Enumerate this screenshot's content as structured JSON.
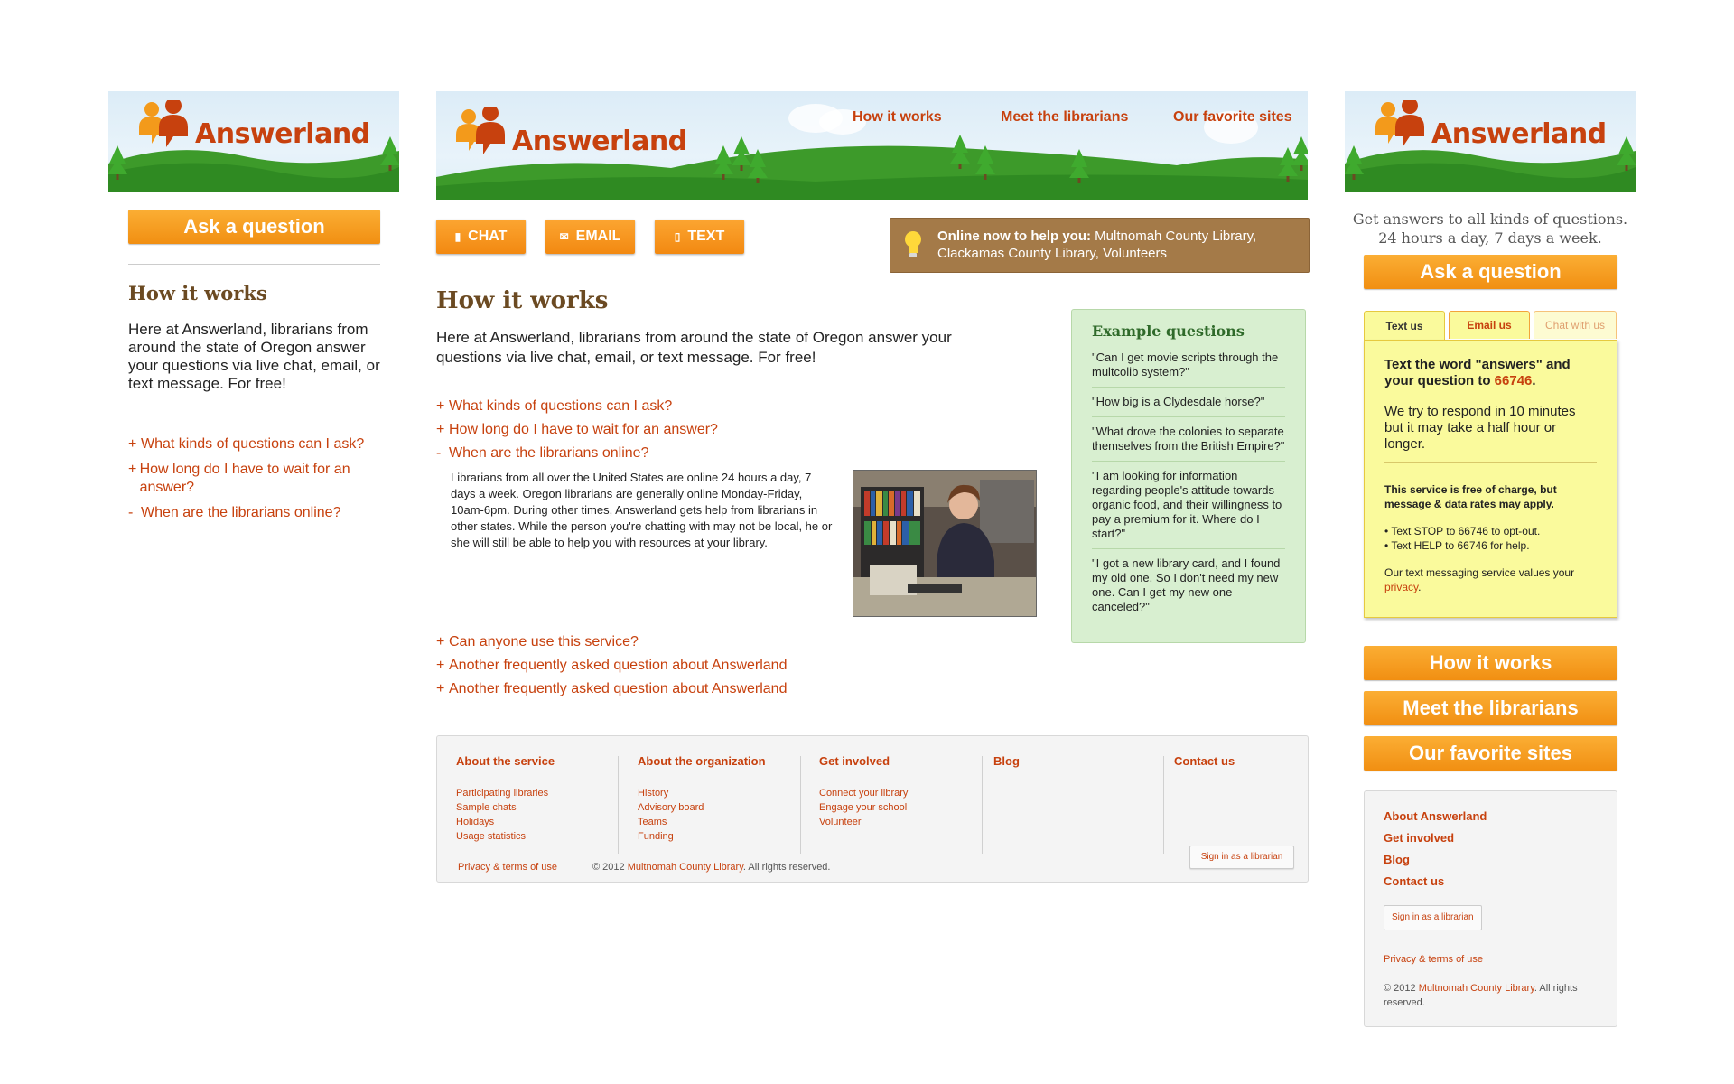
{
  "brand": {
    "name": "Answerland"
  },
  "nav": [
    "How it works",
    "Meet the librarians",
    "Our favorite sites"
  ],
  "left": {
    "ask_button": "Ask a question",
    "heading": "How it works",
    "intro": "Here at Answerland, librarians from around the state of Oregon answer your questions via live chat, email, or text message. For free!",
    "faqs": [
      {
        "sign": "+",
        "text": "What kinds of questions can I ask?"
      },
      {
        "sign": "+",
        "text": "How long do I have to wait for an answer?"
      },
      {
        "sign": "-",
        "text": "When are the librarians online?"
      }
    ]
  },
  "center": {
    "contact_buttons": [
      {
        "label": "CHAT",
        "icon": "chat-bubble-icon"
      },
      {
        "label": "EMAIL",
        "icon": "envelope-icon"
      },
      {
        "label": "TEXT",
        "icon": "phone-icon"
      }
    ],
    "online": {
      "label": "Online now to help you:",
      "value": "Multnomah County Library, Clackamas County Library, Volunteers"
    },
    "heading": "How it works",
    "intro": "Here at Answerland, librarians from around the state of Oregon answer your questions via live chat, email, or text message. For free!",
    "faqs_top": [
      {
        "sign": "+",
        "text": "What kinds of questions can I ask?"
      },
      {
        "sign": "+",
        "text": "How long do I have to wait for an answer?"
      },
      {
        "sign": "-",
        "text": "When are the librarians online?"
      }
    ],
    "answer": "Librarians from all over the United States are online 24 hours a day, 7 days a week. Oregon librarians are generally online Monday-Friday, 10am-6pm. During other times, Answerland gets help from librarians in other states. While the person you're chatting with may not be local, he or she will still be able to help you with resources at your library.",
    "faqs_bottom": [
      {
        "sign": "+",
        "text": "Can anyone use this service?"
      },
      {
        "sign": "+",
        "text": "Another frequently asked question about Answerland"
      },
      {
        "sign": "+",
        "text": "Another frequently asked question about Answerland"
      }
    ],
    "examples": {
      "title": "Example questions",
      "items": [
        "\"Can I get movie scripts through the multcolib system?\"",
        "\"How big is a Clydesdale horse?\"",
        "\"What drove the colonies to separate themselves from the British Empire?\"",
        "\"I am looking for information regarding people's attitude towards organic food, and their willingness to pay a premium for it. Where do I start?\"",
        "\"I got a new library card, and I found my old one. So I don't need my new one. Can I get my new one canceled?\""
      ]
    },
    "footer": {
      "columns": [
        {
          "title": "About the service",
          "links": [
            "Participating libraries",
            "Sample chats",
            "Holidays",
            "Usage statistics"
          ]
        },
        {
          "title": "About the organization",
          "links": [
            "History",
            "Advisory board",
            "Teams",
            "Funding"
          ]
        },
        {
          "title": "Get involved",
          "links": [
            "Connect your library",
            "Engage your school",
            "Volunteer"
          ]
        },
        {
          "title": "Blog",
          "links": []
        },
        {
          "title": "Contact us",
          "links": []
        }
      ],
      "privacy": "Privacy & terms of use",
      "copyright_pre": "© 2012",
      "copyright_org": "Multnomah County Library",
      "copyright_post": ". All rights reserved.",
      "signin": "Sign in as a librarian"
    }
  },
  "right": {
    "tagline_1": "Get answers to all kinds of questions.",
    "tagline_2": "24 hours a day, 7 days a week.",
    "ask_button": "Ask a question",
    "tabs": [
      "Text us",
      "Email us",
      "Chat with us"
    ],
    "text_panel": {
      "heading_pre": "Text the word \"answers\" and your question to",
      "number": "66746",
      "heading_post": ".",
      "respond": "We try to respond in 10 minutes but it may take a half hour or longer.",
      "notice": "This service is free of charge, but message & data rates may apply.",
      "stop": "• Text STOP to 66746 to opt-out.",
      "help": "• Text HELP to 66746 for help.",
      "privacy_pre": "Our text messaging service values your",
      "privacy_link": "privacy",
      "privacy_post": "."
    },
    "nav_buttons": [
      "How it works",
      "Meet the librarians",
      "Our favorite sites"
    ],
    "footer_links": [
      "About Answerland",
      "Get involved",
      "Blog",
      "Contact us"
    ],
    "signin": "Sign in as a librarian",
    "privacy": "Privacy & terms of use",
    "copyright_pre": "© 2012",
    "copyright_org": "Multnomah County Library",
    "copyright_post": ". All rights reserved."
  },
  "colors": {
    "accent": "#c7410e",
    "orange": "#f7981f",
    "brown": "#a47a48",
    "green_panel": "#d8efd0",
    "yellow_panel": "#fafa9c"
  }
}
